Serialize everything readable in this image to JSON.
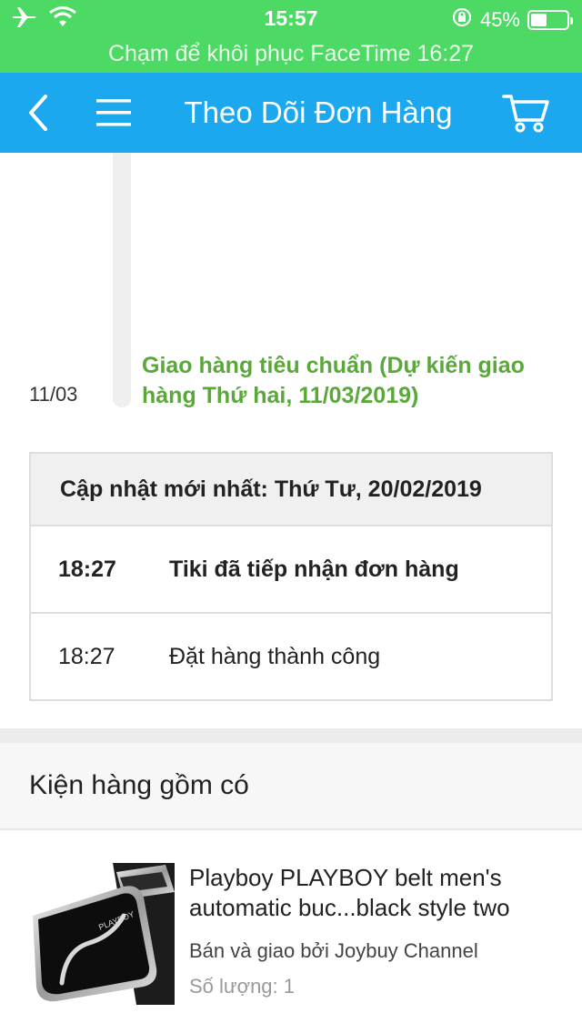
{
  "status_bar": {
    "time": "15:57",
    "battery_percent_label": "45%",
    "battery_level": 0.45,
    "icons": [
      "airplane-icon",
      "wifi-icon",
      "rotation-lock-icon",
      "battery-icon"
    ]
  },
  "facetime_banner": {
    "text": "Chạm để khôi phục FaceTime 16:27"
  },
  "nav": {
    "title": "Theo Dõi Đơn Hàng",
    "icons": [
      "back-icon",
      "menu-icon",
      "cart-icon"
    ],
    "color": "#1ba8ee"
  },
  "timeline": {
    "date": "11/03",
    "text": "Giao hàng tiêu chuẩn (Dự kiến giao hàng Thứ hai, 11/03/2019)",
    "color": "#5aa83a"
  },
  "updates": {
    "header": "Cập nhật mới nhất: Thứ Tư, 20/02/2019",
    "rows": [
      {
        "time": "18:27",
        "desc": "Tiki đã tiếp nhận đơn hàng"
      },
      {
        "time": "18:27",
        "desc": "Đặt hàng thành công"
      }
    ]
  },
  "package": {
    "header": "Kiện hàng gồm có",
    "item": {
      "name": "Playboy PLAYBOY belt men's automatic buc...black style two",
      "seller": "Bán và giao bởi Joybuy Channel",
      "qty_label": "Số lượng:",
      "qty": "1",
      "thumb_brand": "PLAYBOY"
    }
  }
}
